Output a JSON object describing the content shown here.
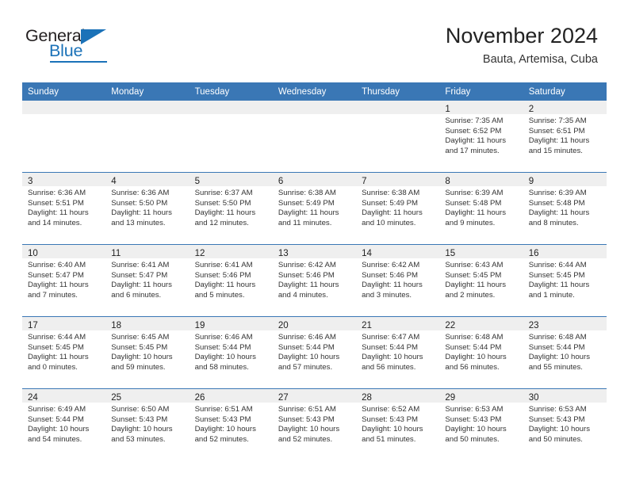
{
  "brand": {
    "name_top": "General",
    "name_bottom": "Blue",
    "accent_color": "#1b72b8"
  },
  "header": {
    "title": "November 2024",
    "subtitle": "Bauta, Artemisa, Cuba"
  },
  "theme": {
    "header_bg": "#3a77b5",
    "daynum_band_bg": "#efefef",
    "week_divider": "#3a77b5",
    "text": "#333333"
  },
  "calendar": {
    "weekday_headers": [
      "Sunday",
      "Monday",
      "Tuesday",
      "Wednesday",
      "Thursday",
      "Friday",
      "Saturday"
    ],
    "weeks": [
      [
        {
          "day": "",
          "empty": true
        },
        {
          "day": "",
          "empty": true
        },
        {
          "day": "",
          "empty": true
        },
        {
          "day": "",
          "empty": true
        },
        {
          "day": "",
          "empty": true
        },
        {
          "day": "1",
          "sunrise": "Sunrise: 7:35 AM",
          "sunset": "Sunset: 6:52 PM",
          "daylight1": "Daylight: 11 hours",
          "daylight2": "and 17 minutes."
        },
        {
          "day": "2",
          "sunrise": "Sunrise: 7:35 AM",
          "sunset": "Sunset: 6:51 PM",
          "daylight1": "Daylight: 11 hours",
          "daylight2": "and 15 minutes."
        }
      ],
      [
        {
          "day": "3",
          "sunrise": "Sunrise: 6:36 AM",
          "sunset": "Sunset: 5:51 PM",
          "daylight1": "Daylight: 11 hours",
          "daylight2": "and 14 minutes."
        },
        {
          "day": "4",
          "sunrise": "Sunrise: 6:36 AM",
          "sunset": "Sunset: 5:50 PM",
          "daylight1": "Daylight: 11 hours",
          "daylight2": "and 13 minutes."
        },
        {
          "day": "5",
          "sunrise": "Sunrise: 6:37 AM",
          "sunset": "Sunset: 5:50 PM",
          "daylight1": "Daylight: 11 hours",
          "daylight2": "and 12 minutes."
        },
        {
          "day": "6",
          "sunrise": "Sunrise: 6:38 AM",
          "sunset": "Sunset: 5:49 PM",
          "daylight1": "Daylight: 11 hours",
          "daylight2": "and 11 minutes."
        },
        {
          "day": "7",
          "sunrise": "Sunrise: 6:38 AM",
          "sunset": "Sunset: 5:49 PM",
          "daylight1": "Daylight: 11 hours",
          "daylight2": "and 10 minutes."
        },
        {
          "day": "8",
          "sunrise": "Sunrise: 6:39 AM",
          "sunset": "Sunset: 5:48 PM",
          "daylight1": "Daylight: 11 hours",
          "daylight2": "and 9 minutes."
        },
        {
          "day": "9",
          "sunrise": "Sunrise: 6:39 AM",
          "sunset": "Sunset: 5:48 PM",
          "daylight1": "Daylight: 11 hours",
          "daylight2": "and 8 minutes."
        }
      ],
      [
        {
          "day": "10",
          "sunrise": "Sunrise: 6:40 AM",
          "sunset": "Sunset: 5:47 PM",
          "daylight1": "Daylight: 11 hours",
          "daylight2": "and 7 minutes."
        },
        {
          "day": "11",
          "sunrise": "Sunrise: 6:41 AM",
          "sunset": "Sunset: 5:47 PM",
          "daylight1": "Daylight: 11 hours",
          "daylight2": "and 6 minutes."
        },
        {
          "day": "12",
          "sunrise": "Sunrise: 6:41 AM",
          "sunset": "Sunset: 5:46 PM",
          "daylight1": "Daylight: 11 hours",
          "daylight2": "and 5 minutes."
        },
        {
          "day": "13",
          "sunrise": "Sunrise: 6:42 AM",
          "sunset": "Sunset: 5:46 PM",
          "daylight1": "Daylight: 11 hours",
          "daylight2": "and 4 minutes."
        },
        {
          "day": "14",
          "sunrise": "Sunrise: 6:42 AM",
          "sunset": "Sunset: 5:46 PM",
          "daylight1": "Daylight: 11 hours",
          "daylight2": "and 3 minutes."
        },
        {
          "day": "15",
          "sunrise": "Sunrise: 6:43 AM",
          "sunset": "Sunset: 5:45 PM",
          "daylight1": "Daylight: 11 hours",
          "daylight2": "and 2 minutes."
        },
        {
          "day": "16",
          "sunrise": "Sunrise: 6:44 AM",
          "sunset": "Sunset: 5:45 PM",
          "daylight1": "Daylight: 11 hours",
          "daylight2": "and 1 minute."
        }
      ],
      [
        {
          "day": "17",
          "sunrise": "Sunrise: 6:44 AM",
          "sunset": "Sunset: 5:45 PM",
          "daylight1": "Daylight: 11 hours",
          "daylight2": "and 0 minutes."
        },
        {
          "day": "18",
          "sunrise": "Sunrise: 6:45 AM",
          "sunset": "Sunset: 5:45 PM",
          "daylight1": "Daylight: 10 hours",
          "daylight2": "and 59 minutes."
        },
        {
          "day": "19",
          "sunrise": "Sunrise: 6:46 AM",
          "sunset": "Sunset: 5:44 PM",
          "daylight1": "Daylight: 10 hours",
          "daylight2": "and 58 minutes."
        },
        {
          "day": "20",
          "sunrise": "Sunrise: 6:46 AM",
          "sunset": "Sunset: 5:44 PM",
          "daylight1": "Daylight: 10 hours",
          "daylight2": "and 57 minutes."
        },
        {
          "day": "21",
          "sunrise": "Sunrise: 6:47 AM",
          "sunset": "Sunset: 5:44 PM",
          "daylight1": "Daylight: 10 hours",
          "daylight2": "and 56 minutes."
        },
        {
          "day": "22",
          "sunrise": "Sunrise: 6:48 AM",
          "sunset": "Sunset: 5:44 PM",
          "daylight1": "Daylight: 10 hours",
          "daylight2": "and 56 minutes."
        },
        {
          "day": "23",
          "sunrise": "Sunrise: 6:48 AM",
          "sunset": "Sunset: 5:44 PM",
          "daylight1": "Daylight: 10 hours",
          "daylight2": "and 55 minutes."
        }
      ],
      [
        {
          "day": "24",
          "sunrise": "Sunrise: 6:49 AM",
          "sunset": "Sunset: 5:44 PM",
          "daylight1": "Daylight: 10 hours",
          "daylight2": "and 54 minutes."
        },
        {
          "day": "25",
          "sunrise": "Sunrise: 6:50 AM",
          "sunset": "Sunset: 5:43 PM",
          "daylight1": "Daylight: 10 hours",
          "daylight2": "and 53 minutes."
        },
        {
          "day": "26",
          "sunrise": "Sunrise: 6:51 AM",
          "sunset": "Sunset: 5:43 PM",
          "daylight1": "Daylight: 10 hours",
          "daylight2": "and 52 minutes."
        },
        {
          "day": "27",
          "sunrise": "Sunrise: 6:51 AM",
          "sunset": "Sunset: 5:43 PM",
          "daylight1": "Daylight: 10 hours",
          "daylight2": "and 52 minutes."
        },
        {
          "day": "28",
          "sunrise": "Sunrise: 6:52 AM",
          "sunset": "Sunset: 5:43 PM",
          "daylight1": "Daylight: 10 hours",
          "daylight2": "and 51 minutes."
        },
        {
          "day": "29",
          "sunrise": "Sunrise: 6:53 AM",
          "sunset": "Sunset: 5:43 PM",
          "daylight1": "Daylight: 10 hours",
          "daylight2": "and 50 minutes."
        },
        {
          "day": "30",
          "sunrise": "Sunrise: 6:53 AM",
          "sunset": "Sunset: 5:43 PM",
          "daylight1": "Daylight: 10 hours",
          "daylight2": "and 50 minutes."
        }
      ]
    ]
  }
}
